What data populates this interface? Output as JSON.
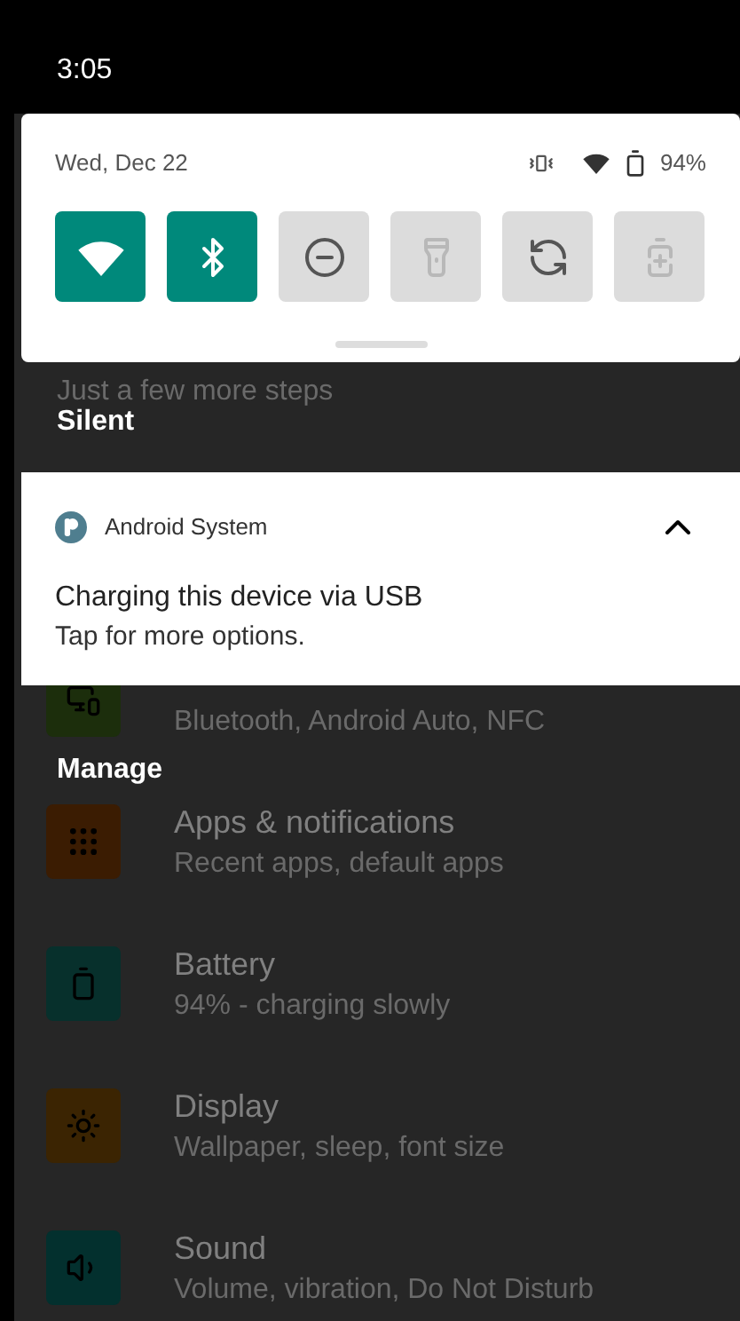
{
  "status_bar": {
    "time": "3:05"
  },
  "quick_settings": {
    "date": "Wed, Dec 22",
    "battery_percent": "94%",
    "tiles": [
      {
        "kind": "wifi",
        "on": true,
        "disabled": false
      },
      {
        "kind": "bluetooth",
        "on": true,
        "disabled": false
      },
      {
        "kind": "dnd",
        "on": false,
        "disabled": false
      },
      {
        "kind": "flashlight",
        "on": false,
        "disabled": true
      },
      {
        "kind": "rotate",
        "on": false,
        "disabled": false
      },
      {
        "kind": "battery_saver",
        "on": false,
        "disabled": true
      }
    ]
  },
  "settings_background": {
    "setup_subtitle": "Just a few more steps",
    "items": [
      {
        "kind": "devices",
        "subtitle": "Bluetooth, Android Auto, NFC",
        "color": "#1c2e0c"
      },
      {
        "kind": "apps",
        "title": "Apps & notifications",
        "subtitle": "Recent apps, default apps",
        "color": "#3b1c02"
      },
      {
        "kind": "battery",
        "title": "Battery",
        "subtitle": "94% - charging slowly",
        "color": "#07302c"
      },
      {
        "kind": "display",
        "title": "Display",
        "subtitle": "Wallpaper, sleep, font size",
        "color": "#3b2402"
      },
      {
        "kind": "sound",
        "title": "Sound",
        "subtitle": "Volume, vibration, Do Not Disturb",
        "color": "#03302e"
      }
    ]
  },
  "silent_header": "Silent",
  "notification": {
    "app": "Android System",
    "title": "Charging this device via USB",
    "text": "Tap for more options.",
    "expanded": true
  },
  "manage": "Manage"
}
